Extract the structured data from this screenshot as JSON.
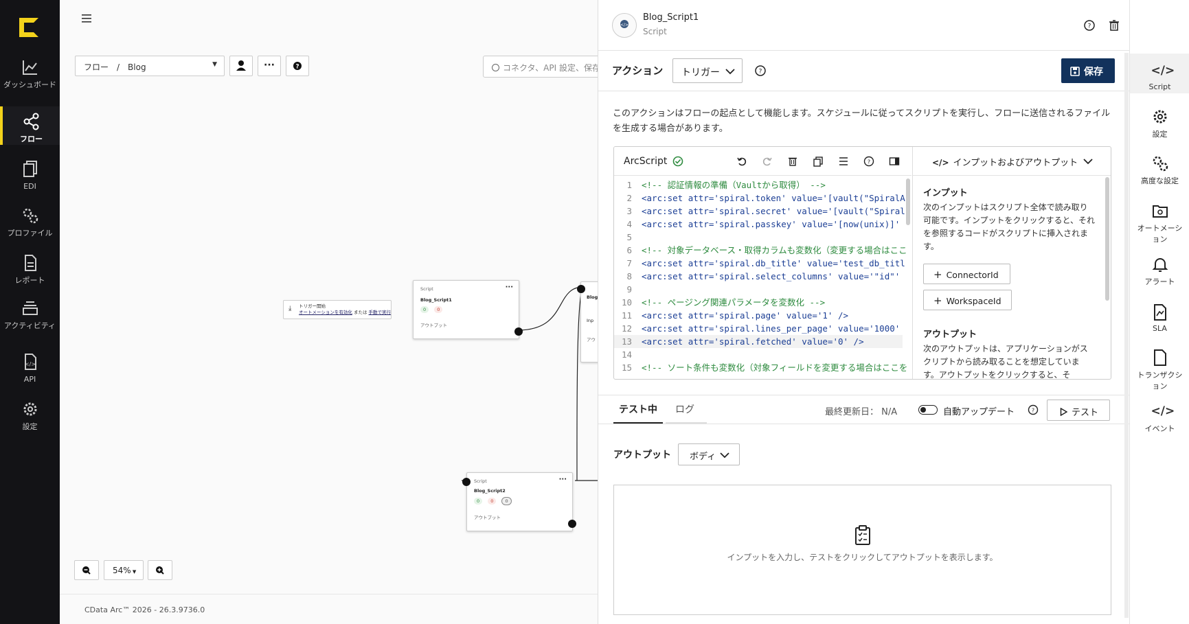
{
  "nav": {
    "items": [
      {
        "label": "ダッシュボード",
        "icon": "chart-line-icon"
      },
      {
        "label": "フロー",
        "icon": "flow-share-icon",
        "active": true
      },
      {
        "label": "EDI",
        "icon": "documents-icon"
      },
      {
        "label": "プロファイル",
        "icon": "gears-icon"
      },
      {
        "label": "レポート",
        "icon": "report-icon"
      },
      {
        "label": "アクティビティ",
        "icon": "layers-icon"
      },
      {
        "label": "API",
        "icon": "api-file-icon"
      },
      {
        "label": "設定",
        "icon": "gear-icon"
      }
    ]
  },
  "canvas": {
    "breadcrumb": "フロー　/　Blog",
    "search_placeholder": "コネクタ、API 設定、保存",
    "zoom": "54%",
    "footer": "CData Arc™ 2026 - 26.3.9736.0",
    "trigger_title": "トリガー開始",
    "trigger_link1": "オートメーションを有効化",
    "trigger_mid": "または",
    "trigger_link2": "手動で実行",
    "node1": {
      "type": "Script",
      "name": "Blog_Script1",
      "badge_a": "0",
      "badge_b": "0",
      "output": "アウトプット"
    },
    "node2": {
      "type": "Script",
      "name": "Blog_Script2",
      "badge_a": "0",
      "badge_b": "0",
      "badge_c": "0",
      "output": "アウトプット"
    },
    "node3_partial": "Blog",
    "node3_partial2": "Inp",
    "node3_partial3": "アウ"
  },
  "panel": {
    "title": "Blog_Script1",
    "subtitle": "Script",
    "action_label": "アクション",
    "action_value": "トリガー",
    "save_label": "保存",
    "description": "このアクションはフローの起点として機能します。スケジュールに従ってスクリプトを実行し、フローに送信されるファイルを生成する場合があります。",
    "editor_title": "ArcScript",
    "io_header": "インプットおよびアウトプット",
    "input_title": "インプット",
    "input_desc": "次のインプットはスクリプト全体で読み取り可能です。インプットをクリックすると、それを参照するコードがスクリプトに挿入されます。",
    "input_btn1": "ConnectorId",
    "input_btn2": "WorkspaceId",
    "output_title": "アウトプット",
    "output_desc": "次のアウトプットは、アプリケーションがスクリプトから読み取ることを想定しています。アウトプットをクリックすると、そ",
    "code_lines": [
      {
        "n": "1",
        "t": "<!-- 認証情報の準備（Vaultから取得） -->"
      },
      {
        "n": "2",
        "t": "<arc:set attr='spiral.token' value='[vault(\"SpiralA"
      },
      {
        "n": "3",
        "t": "<arc:set attr='spiral.secret' value='[vault(\"Spiral"
      },
      {
        "n": "4",
        "t": "<arc:set attr='spiral.passkey' value='[now(unix)]'"
      },
      {
        "n": "5",
        "t": ""
      },
      {
        "n": "6",
        "t": "<!-- 対象データベース・取得カラムも変数化（変更する場合はここ"
      },
      {
        "n": "7",
        "t": "<arc:set attr='spiral.db_title' value='test_db_titl"
      },
      {
        "n": "8",
        "t": "<arc:set attr='spiral.select_columns' value='\"id\"'"
      },
      {
        "n": "9",
        "t": ""
      },
      {
        "n": "10",
        "t": "<!-- ページング関連パラメータを変数化 -->"
      },
      {
        "n": "11",
        "t": "<arc:set attr='spiral.page' value='1' />"
      },
      {
        "n": "12",
        "t": "<arc:set attr='spiral.lines_per_page' value='1000'"
      },
      {
        "n": "13",
        "t": "<arc:set attr='spiral.fetched' value='0' />"
      },
      {
        "n": "14",
        "t": ""
      },
      {
        "n": "15",
        "t": "<!-- ソート条件も変数化（対象フィールドを変更する場合はここを"
      }
    ],
    "tab_testing": "テスト中",
    "tab_log": "ログ",
    "last_updated_label": "最終更新日：",
    "last_updated_value": "N/A",
    "auto_update_label": "自動アップデート",
    "test_button": "テスト",
    "output_label": "アウトプット",
    "output_select": "ボディ",
    "output_empty": "インプットを入力し、テストをクリックしてアウトプットを表示します。"
  },
  "rail": {
    "items": [
      {
        "label": "Script",
        "icon": "code-icon",
        "active": true
      },
      {
        "label": "設定",
        "icon": "gear-icon"
      },
      {
        "label": "高度な設定",
        "icon": "gears-icon"
      },
      {
        "label": "オートメーション",
        "icon": "automation-folder-icon"
      },
      {
        "label": "アラート",
        "icon": "bell-icon"
      },
      {
        "label": "SLA",
        "icon": "sla-file-icon"
      },
      {
        "label": "トランザクション",
        "icon": "transaction-file-icon"
      },
      {
        "label": "イベント",
        "icon": "code-icon"
      }
    ]
  },
  "colors": {
    "accent": "#f3d21b",
    "save": "#12325c",
    "green": "#2e8b3f",
    "red": "#c0392b"
  }
}
